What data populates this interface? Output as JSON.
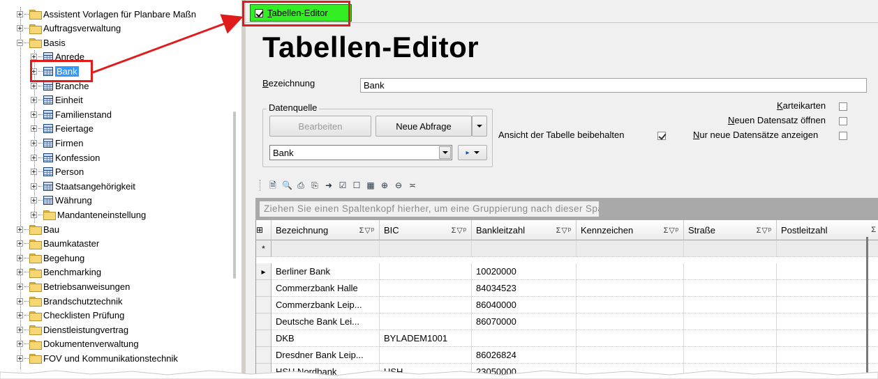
{
  "tree": {
    "items": [
      {
        "label": "Assistent Vorlagen für Planbare Maßn",
        "level": 0,
        "type": "folder",
        "expander": "plus"
      },
      {
        "label": "Auftragsverwaltung",
        "level": 0,
        "type": "folder",
        "expander": "plus"
      },
      {
        "label": "Basis",
        "level": 0,
        "type": "folder",
        "expander": "minus"
      },
      {
        "label": "Anrede",
        "level": 1,
        "type": "table",
        "expander": "plus"
      },
      {
        "label": "Bank",
        "level": 1,
        "type": "table",
        "expander": "plus",
        "selected": true
      },
      {
        "label": "Branche",
        "level": 1,
        "type": "table",
        "expander": "plus"
      },
      {
        "label": "Einheit",
        "level": 1,
        "type": "table",
        "expander": "plus"
      },
      {
        "label": "Familienstand",
        "level": 1,
        "type": "table",
        "expander": "plus"
      },
      {
        "label": "Feiertage",
        "level": 1,
        "type": "table",
        "expander": "plus"
      },
      {
        "label": "Firmen",
        "level": 1,
        "type": "table",
        "expander": "plus"
      },
      {
        "label": "Konfession",
        "level": 1,
        "type": "table",
        "expander": "plus"
      },
      {
        "label": "Person",
        "level": 1,
        "type": "table",
        "expander": "plus"
      },
      {
        "label": "Staatsangehörigkeit",
        "level": 1,
        "type": "table",
        "expander": "plus"
      },
      {
        "label": "Währung",
        "level": 1,
        "type": "table",
        "expander": "plus"
      },
      {
        "label": "Mandanteneinstellung",
        "level": 1,
        "type": "folder",
        "expander": "plus"
      },
      {
        "label": "Bau",
        "level": 0,
        "type": "folder",
        "expander": "plus"
      },
      {
        "label": "Baumkataster",
        "level": 0,
        "type": "folder",
        "expander": "plus"
      },
      {
        "label": "Begehung",
        "level": 0,
        "type": "folder",
        "expander": "plus"
      },
      {
        "label": "Benchmarking",
        "level": 0,
        "type": "folder",
        "expander": "plus"
      },
      {
        "label": "Betriebsanweisungen",
        "level": 0,
        "type": "folder",
        "expander": "plus"
      },
      {
        "label": "Brandschutztechnik",
        "level": 0,
        "type": "folder",
        "expander": "plus"
      },
      {
        "label": "Checklisten Prüfung",
        "level": 0,
        "type": "folder",
        "expander": "plus"
      },
      {
        "label": "Dienstleistungvertrag",
        "level": 0,
        "type": "folder",
        "expander": "plus"
      },
      {
        "label": "Dokumentenverwaltung",
        "level": 0,
        "type": "folder",
        "expander": "plus"
      },
      {
        "label": "FOV und Kommunikationstechnik",
        "level": 0,
        "type": "folder",
        "expander": "plus"
      }
    ]
  },
  "tab": {
    "label": "Tabellen-Editor",
    "checked": true
  },
  "editor": {
    "title": "Tabellen-Editor",
    "bezeichnung_label": "Bezeichnung",
    "bezeichnung_value": "Bank",
    "datenquelle": {
      "legend": "Datenquelle",
      "edit_button": "Bearbeiten",
      "new_query_button": "Neue Abfrage",
      "source_value": "Bank"
    },
    "options": {
      "keep_view_label": "Ansicht der Tabelle beibehalten",
      "keep_view_checked": true,
      "karteikarten_label": "Karteikarten",
      "karteikarten_checked": false,
      "new_record_label": "Neuen Datensatz öffnen",
      "new_record_checked": false,
      "only_new_label": "Nur neue Datensätze anzeigen",
      "only_new_checked": false
    },
    "toolbar_icons": [
      "new-document-icon",
      "search-icon",
      "print-icon",
      "print-preview-icon",
      "export-icon",
      "checkbox-icon",
      "window-icon",
      "columns-icon",
      "expand-icon",
      "collapse-icon",
      "grid-settings-icon"
    ],
    "group_hint": "Ziehen Sie einen Spaltenkopf hierher, um eine Gruppierung nach dieser Spalte vorzunehmen.",
    "grid": {
      "column_symbols": "Σ▽ᵖ",
      "columns": [
        "Bezeichnung",
        "BIC",
        "Bankleitzahl",
        "Kennzeichen",
        "Straße",
        "Postleitzahl"
      ],
      "new_row_marker": "*",
      "current_row_marker": "▸",
      "rows": [
        {
          "bezeichnung": "Berliner Bank",
          "bic": "",
          "blz": "10020000"
        },
        {
          "bezeichnung": "Commerzbank Halle",
          "bic": "",
          "blz": "84034523"
        },
        {
          "bezeichnung": "Commerzbank Leip...",
          "bic": "",
          "blz": "86040000"
        },
        {
          "bezeichnung": "Deutsche Bank Lei...",
          "bic": "",
          "blz": "86070000"
        },
        {
          "bezeichnung": "DKB",
          "bic": "BYLADEM1001",
          "blz": ""
        },
        {
          "bezeichnung": "Dresdner Bank Leip...",
          "bic": "",
          "blz": "86026824"
        },
        {
          "bezeichnung": "HSH Nordbank",
          "bic": "HSH",
          "blz": "23050000"
        }
      ]
    }
  }
}
